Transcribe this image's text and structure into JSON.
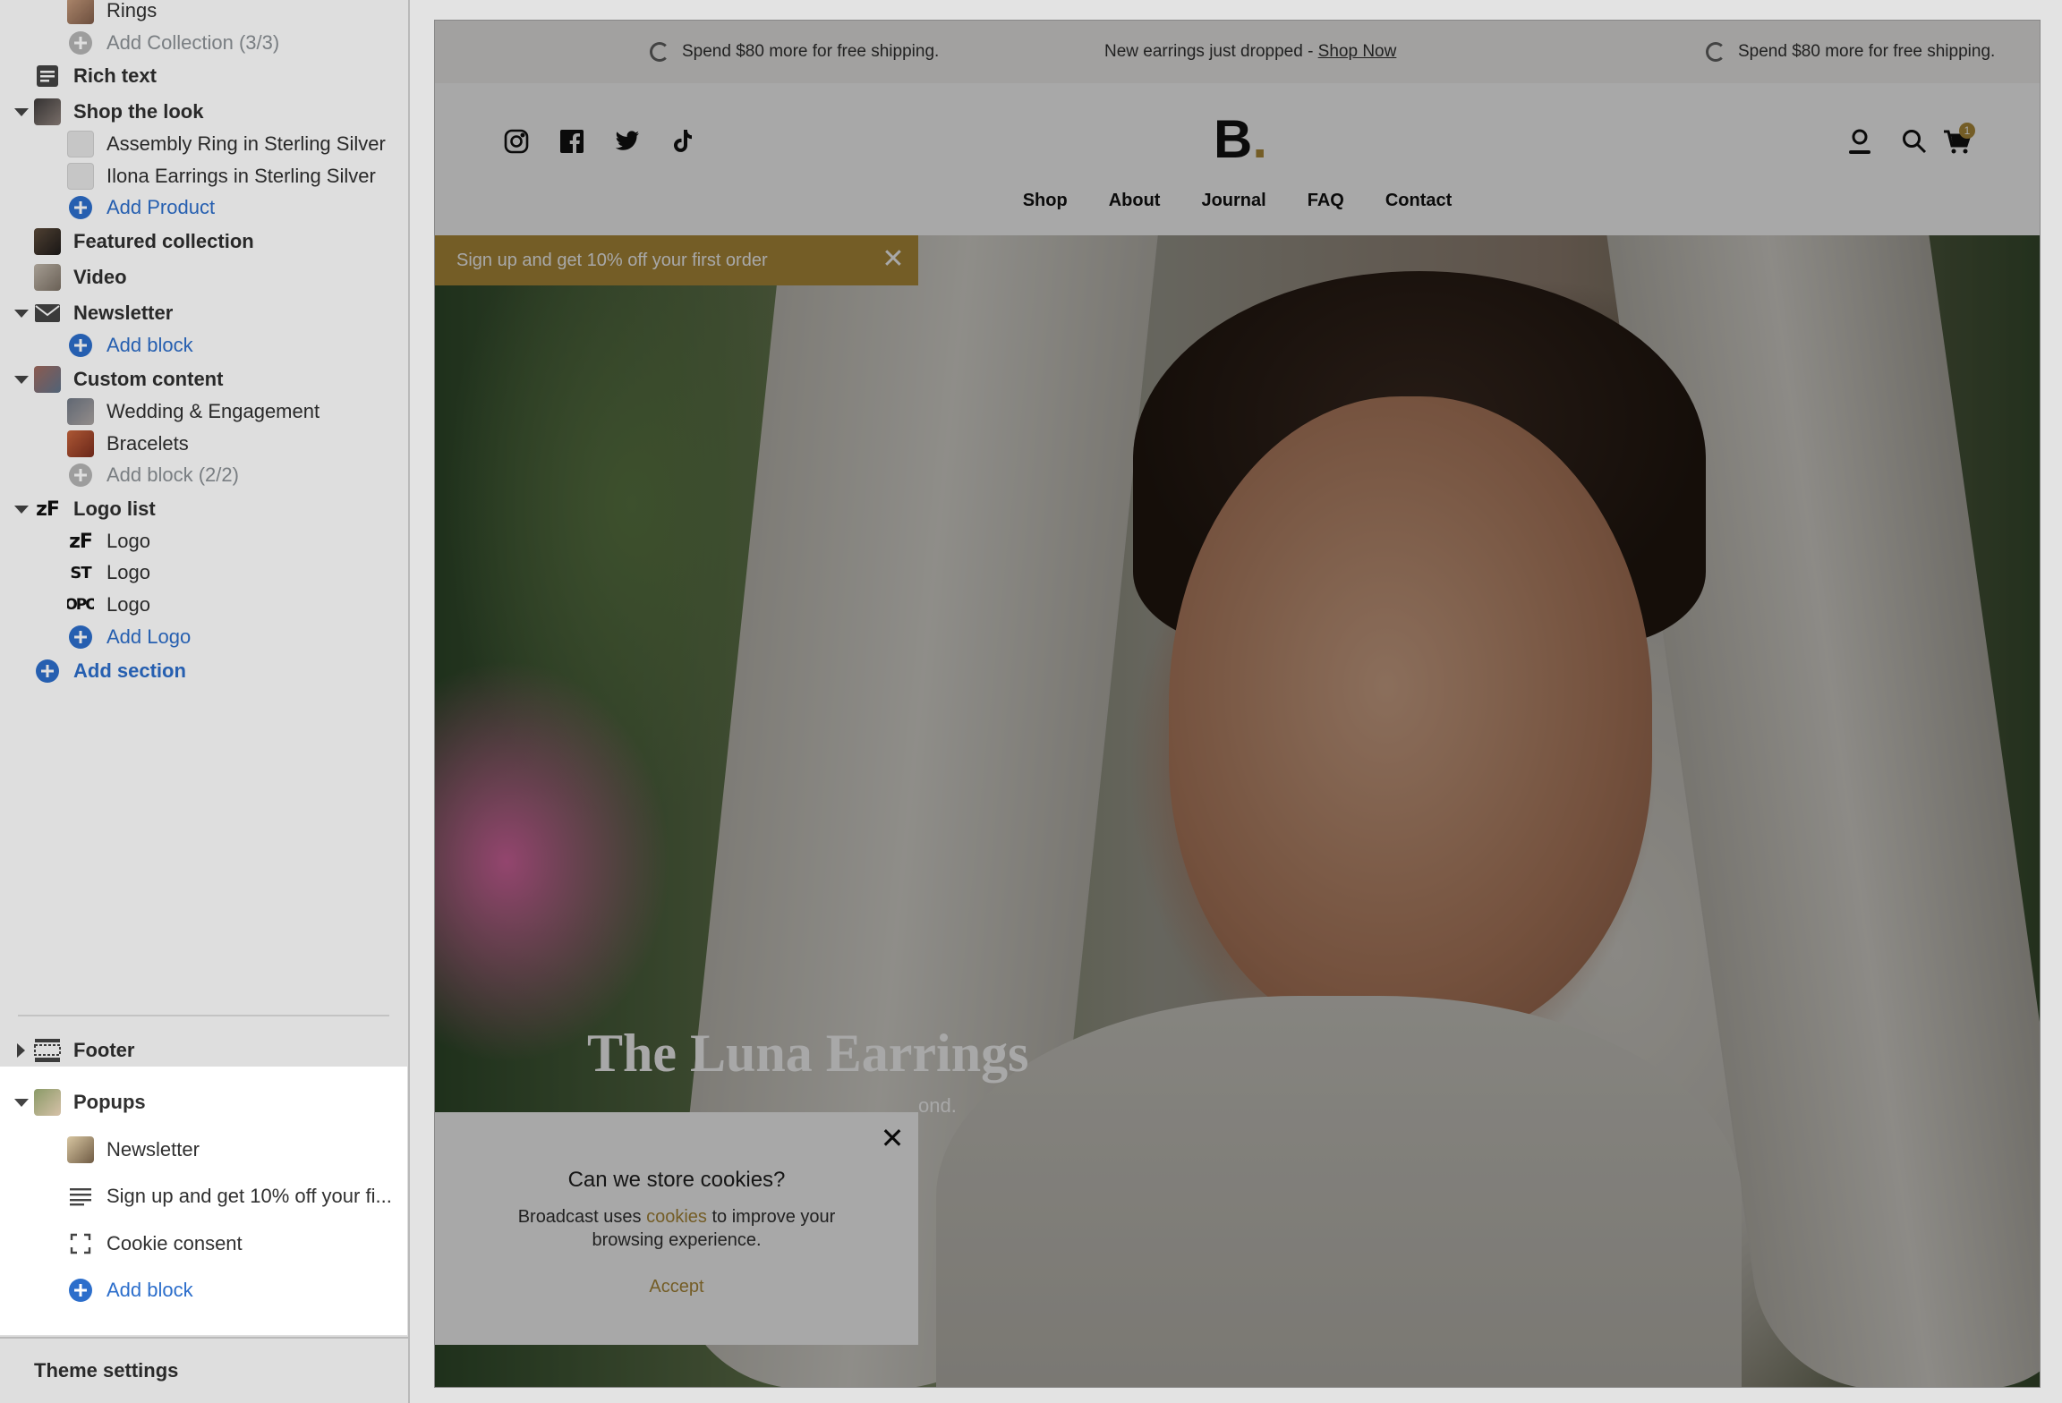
{
  "sidebar": {
    "top_items": [
      {
        "label": "Rings"
      },
      {
        "label": "Add Collection (3/3)"
      },
      {
        "label": "Rich text"
      },
      {
        "label": "Shop the look"
      },
      {
        "label": "Assembly Ring in Sterling Silver"
      },
      {
        "label": "Ilona Earrings in Sterling Silver"
      },
      {
        "label": "Add Product"
      },
      {
        "label": "Featured collection"
      },
      {
        "label": "Video"
      },
      {
        "label": "Newsletter"
      },
      {
        "label": "Add block"
      },
      {
        "label": "Custom content"
      },
      {
        "label": "Wedding & Engagement"
      },
      {
        "label": "Bracelets"
      },
      {
        "label": "Add block (2/2)"
      },
      {
        "label": "Logo list"
      },
      {
        "label": "Logo"
      },
      {
        "label": "Logo"
      },
      {
        "label": "Logo"
      },
      {
        "label": "Add Logo"
      },
      {
        "label": "Add section"
      }
    ],
    "logo_glyphs": [
      "zF",
      "ST",
      "OPO"
    ],
    "logo_list_glyph": "zF",
    "footer": {
      "label": "Footer"
    },
    "popups": {
      "label": "Popups",
      "items": [
        {
          "label": "Newsletter"
        },
        {
          "label": "Sign up and get 10% off your fi..."
        },
        {
          "label": "Cookie consent"
        },
        {
          "label": "Add block"
        }
      ]
    },
    "theme_settings": "Theme settings"
  },
  "preview": {
    "announcement": {
      "left": "Spend $80 more for free shipping.",
      "center": "New earrings just dropped - ",
      "center_link": "Shop Now",
      "right": "Spend $80 more for free shipping."
    },
    "brand": {
      "letter": "B",
      "dot": "."
    },
    "cart_count": "1",
    "nav": [
      "Shop",
      "About",
      "Journal",
      "FAQ",
      "Contact"
    ],
    "promo_bar": "Sign up and get 10% off your first order",
    "hero": {
      "title": "The Luna Earrings",
      "subtitle": "ond."
    },
    "cookie": {
      "title": "Can we store cookies?",
      "body_before": "Broadcast uses ",
      "body_link": "cookies",
      "body_after": " to improve your browsing experience.",
      "accept": "Accept"
    }
  },
  "colors": {
    "accent_blue": "#2c6ecb",
    "brand_gold": "#b08d3a",
    "disabled_gray": "#8c9196"
  }
}
